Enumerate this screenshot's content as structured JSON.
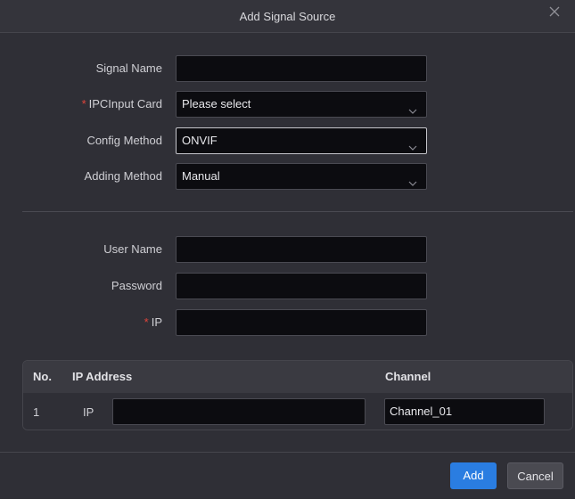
{
  "dialog": {
    "title": "Add Signal Source",
    "close_icon": "close-icon"
  },
  "form": {
    "signal_name": {
      "label": "Signal Name",
      "value": ""
    },
    "ipc_input_card": {
      "label": "IPCInput Card",
      "required_mark": "*",
      "value": "Please select"
    },
    "config_method": {
      "label": "Config Method",
      "value": "ONVIF"
    },
    "adding_method": {
      "label": "Adding Method",
      "value": "Manual"
    },
    "user_name": {
      "label": "User Name",
      "value": ""
    },
    "password": {
      "label": "Password",
      "value": ""
    },
    "ip": {
      "label": "IP",
      "required_mark": "*",
      "value": ""
    }
  },
  "table": {
    "headers": {
      "no": "No.",
      "ip_address": "IP Address",
      "channel": "Channel"
    },
    "rows": [
      {
        "no": "1",
        "ip_label": "IP",
        "ip_value": "",
        "channel": "Channel_01"
      }
    ]
  },
  "footer": {
    "add_label": "Add",
    "cancel_label": "Cancel"
  },
  "colors": {
    "accent": "#2a7de1",
    "required": "#e0443b",
    "background": "#2f2f36",
    "input_background": "#0c0c10"
  }
}
